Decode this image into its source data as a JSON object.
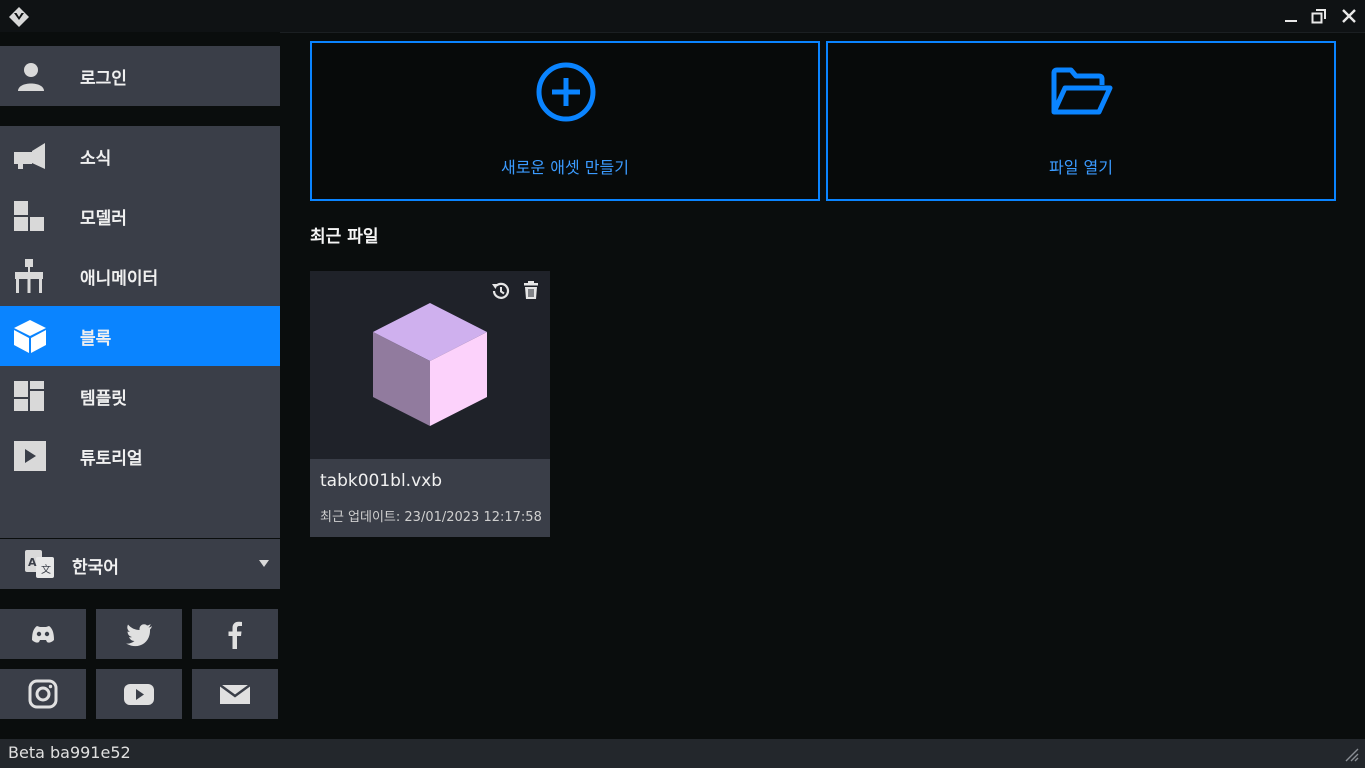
{
  "window": {
    "logo_icon": "voxedit-logo-icon",
    "controls": [
      "minimize-icon",
      "restore-icon",
      "close-icon"
    ]
  },
  "sidebar": {
    "login_label": "로그인",
    "items": [
      {
        "label": "소식",
        "icon": "megaphone-icon",
        "active": false
      },
      {
        "label": "모델러",
        "icon": "modeler-blocks-icon",
        "active": false
      },
      {
        "label": "애니메이터",
        "icon": "animator-hierarchy-icon",
        "active": false
      },
      {
        "label": "블록",
        "icon": "cube-icon",
        "active": true
      },
      {
        "label": "템플릿",
        "icon": "template-grid-icon",
        "active": false
      },
      {
        "label": "튜토리얼",
        "icon": "play-icon",
        "active": false
      }
    ],
    "language": {
      "label": "한국어",
      "icon": "translate-icon"
    },
    "social": [
      "discord-icon",
      "twitter-icon",
      "facebook-icon",
      "instagram-icon",
      "youtube-icon",
      "mail-icon"
    ]
  },
  "main": {
    "actions": {
      "new_asset": "새로운 애셋 만들기",
      "open_file": "파일 열기"
    },
    "recent_title": "최근 파일",
    "recent_files": [
      {
        "name": "tabk001bl.vxb",
        "updated": "최근 업데이트: 23/01/2023 12:17:58"
      }
    ]
  },
  "status": {
    "version": "Beta ba991e52"
  },
  "colors": {
    "accent": "#0a84ff",
    "panel": "#3a3e48",
    "background": "#0a0d0d"
  }
}
